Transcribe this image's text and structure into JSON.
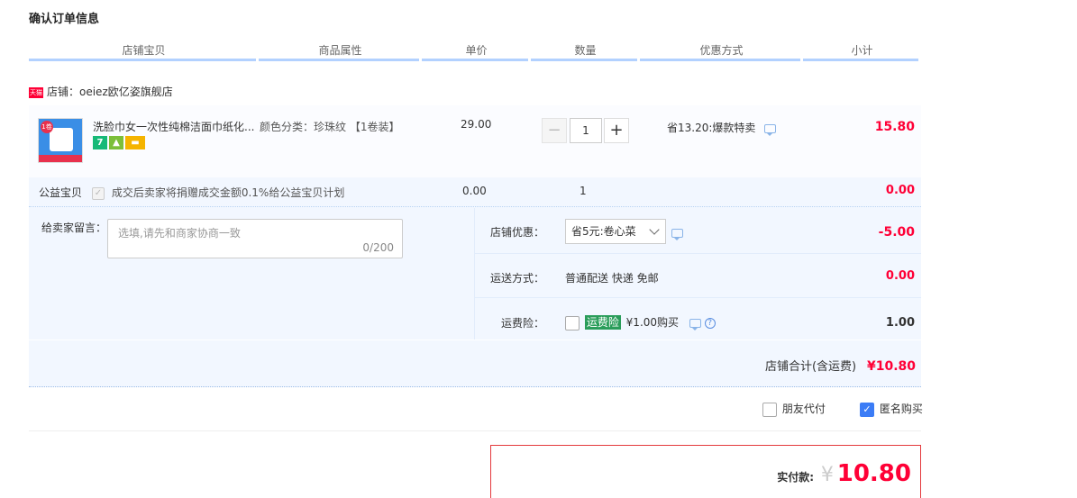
{
  "page_title": "确认订单信息",
  "headers": [
    "店铺宝贝",
    "商品属性",
    "单价",
    "数量",
    "优惠方式",
    "小计"
  ],
  "shop": {
    "badge": "天猫",
    "label": "店铺：oeiez欧亿姿旗舰店"
  },
  "item": {
    "name": "洗脸巾女一次性纯棉洁面巾纸化...",
    "thumb_badge": "1卷",
    "icons": [
      "seven-day-return-icon",
      "android-icon",
      "card-payment-icon"
    ],
    "icon_text": {
      "seven": "7"
    },
    "attribute": "颜色分类：珍珠纹 【1卷装】",
    "price": "29.00",
    "quantity": "1",
    "minus": "−",
    "plus": "+",
    "promo": "省13.20:爆款特卖",
    "subtotal": "15.80"
  },
  "charity": {
    "label": "公益宝贝",
    "check": "✓",
    "text": "成交后卖家将捐赠成交金额0.1%给公益宝贝计划",
    "price": "0.00",
    "quantity": "1",
    "subtotal": "0.00"
  },
  "remark": {
    "label": "给卖家留言：",
    "placeholder": "选填,请先和商家协商一致",
    "counter": "0/200"
  },
  "shop_discount": {
    "label": "店铺优惠：",
    "selected": "省5元:卷心菜",
    "amount": "-5.00"
  },
  "shipping": {
    "label": "运送方式：",
    "value": "普通配送 快递 免邮",
    "amount": "0.00"
  },
  "insurance": {
    "label": "运费险：",
    "tag": "运费险",
    "text": "¥1.00购买",
    "help": "?",
    "amount": "1.00"
  },
  "shop_total": {
    "label": "店铺合计(含运费)",
    "amount": "¥10.80"
  },
  "options": {
    "friend_pay": "朋友代付",
    "anonymous": "匿名购买",
    "anonymous_check": "✓"
  },
  "pay": {
    "label": "实付款:",
    "currency": "¥",
    "amount": "10.80"
  },
  "colors": {
    "accent_red": "#ff0036",
    "header_line": "#b2d1ff",
    "panel_bg": "#f2f7ff",
    "checkbox_blue": "#3b7cf6"
  }
}
